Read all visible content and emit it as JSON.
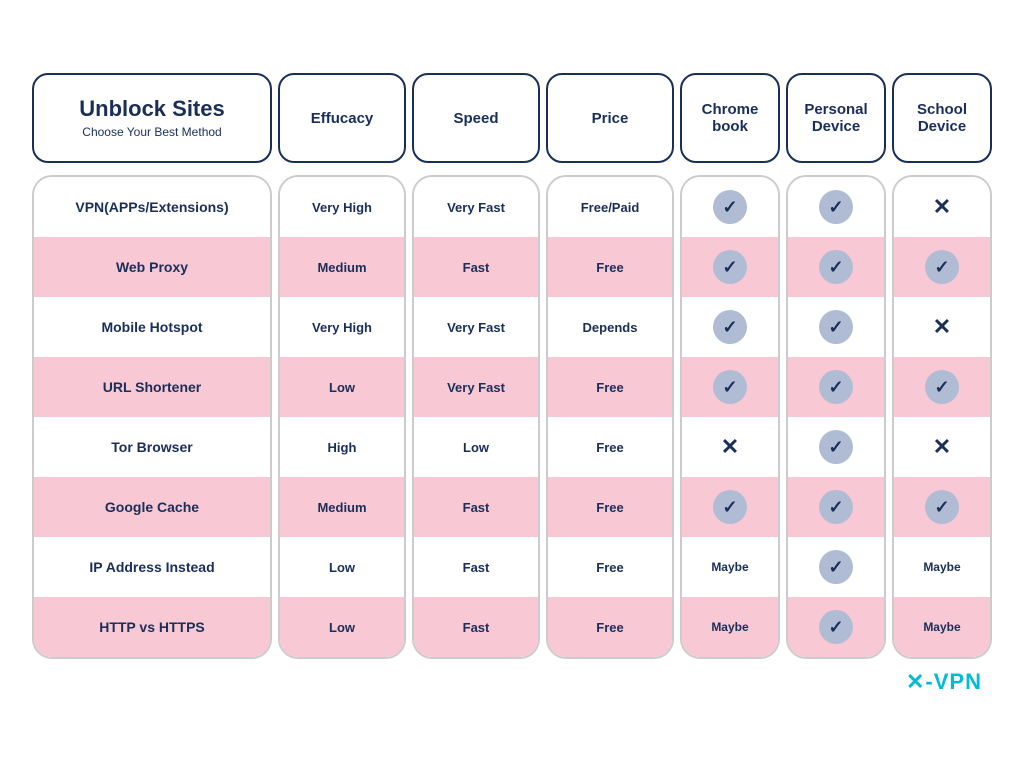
{
  "header": {
    "title": "Unblock Sites",
    "subtitle": "Choose Your Best Method",
    "cols": [
      "Effucacy",
      "Speed",
      "Price",
      "Chrome book",
      "Personal Device",
      "School Device"
    ]
  },
  "rows": [
    {
      "method": "VPN(APPs/Extensions)",
      "efficacy": "Very High",
      "speed": "Very Fast",
      "price": "Free/Paid",
      "chromebook": "check",
      "personal": "check",
      "school": "x",
      "bg": "white"
    },
    {
      "method": "Web Proxy",
      "efficacy": "Medium",
      "speed": "Fast",
      "price": "Free",
      "chromebook": "check",
      "personal": "check",
      "school": "check",
      "bg": "pink"
    },
    {
      "method": "Mobile Hotspot",
      "efficacy": "Very High",
      "speed": "Very Fast",
      "price": "Depends",
      "chromebook": "check",
      "personal": "check",
      "school": "x",
      "bg": "white"
    },
    {
      "method": "URL Shortener",
      "efficacy": "Low",
      "speed": "Very Fast",
      "price": "Free",
      "chromebook": "check",
      "personal": "check",
      "school": "check",
      "bg": "pink"
    },
    {
      "method": "Tor Browser",
      "efficacy": "High",
      "speed": "Low",
      "price": "Free",
      "chromebook": "x",
      "personal": "check",
      "school": "x",
      "bg": "white"
    },
    {
      "method": "Google Cache",
      "efficacy": "Medium",
      "speed": "Fast",
      "price": "Free",
      "chromebook": "check",
      "personal": "check",
      "school": "check",
      "bg": "pink"
    },
    {
      "method": "IP Address Instead",
      "efficacy": "Low",
      "speed": "Fast",
      "price": "Free",
      "chromebook": "maybe",
      "personal": "check",
      "school": "maybe",
      "bg": "white"
    },
    {
      "method": "HTTP vs HTTPS",
      "efficacy": "Low",
      "speed": "Fast",
      "price": "Free",
      "chromebook": "maybe",
      "personal": "check",
      "school": "maybe",
      "bg": "pink"
    }
  ],
  "logo": "✕-VPN"
}
